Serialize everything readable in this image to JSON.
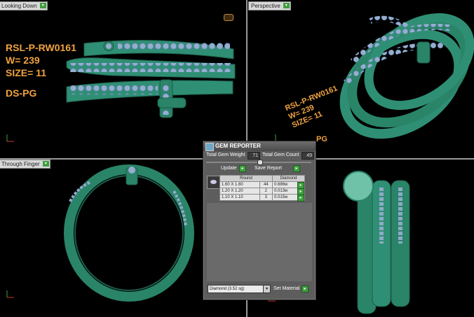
{
  "viewports": {
    "top_left": {
      "label": "Looking Down"
    },
    "top_right": {
      "label": "Perspective"
    },
    "bottom_left": {
      "label": "Through Finger"
    }
  },
  "annotation_left": {
    "line1": "RSL-P-RW0161",
    "line2": "W= 239",
    "line3": "SIZE= 11",
    "line4": "DS-PG"
  },
  "annotation_right": {
    "line1": "RSL-P-RW0161",
    "line2": "W= 239",
    "line3": "SIZE= 11",
    "line4": "PG"
  },
  "gem_reporter": {
    "title": "GEM REPORTER",
    "weight_label": "Total Gem Weight",
    "weight_value": "71",
    "count_label": "Total Gem Count",
    "count_value": "49",
    "update_label": "Update",
    "save_label": "Save Report",
    "columns": [
      "Round",
      "Diamond"
    ],
    "rows": [
      {
        "size": "1.60 X 1.60",
        "count": "44",
        "weight": "0.686w"
      },
      {
        "size": "1.20 X 1.20",
        "count": "2",
        "weight": "0.013w"
      },
      {
        "size": "1.10 X 1.10",
        "count": "3",
        "weight": "0.015w"
      }
    ],
    "material_value": "Diamond    (3.52 sg)",
    "set_material_label": "Set Material"
  },
  "colors": {
    "metal": "#2f8f74",
    "gem": "#8fa9c9",
    "annot": "#f0a340"
  }
}
